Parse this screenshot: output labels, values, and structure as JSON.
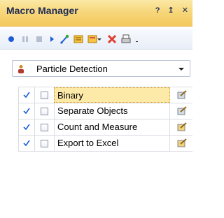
{
  "window": {
    "title": "Macro Manager",
    "title_buttons": "?  ×"
  },
  "toolbar": {
    "items": [
      {
        "name": "record-icon"
      },
      {
        "name": "pause-icon"
      },
      {
        "name": "stop-icon"
      },
      {
        "name": "play-icon"
      },
      {
        "name": "step-icon"
      },
      {
        "name": "macro-insert-icon"
      },
      {
        "name": "macro-dropdown-icon"
      },
      {
        "name": "delete-icon"
      },
      {
        "name": "print-icon"
      }
    ]
  },
  "macro_selector": {
    "label": "Particle Detection",
    "icon": "person-icon"
  },
  "steps": [
    {
      "name": "Binary",
      "checked": true,
      "selected": true
    },
    {
      "name": "Separate Objects",
      "checked": true,
      "selected": false
    },
    {
      "name": "Count and Measure",
      "checked": true,
      "selected": false
    },
    {
      "name": "Export to Excel",
      "checked": true,
      "selected": false
    }
  ],
  "colors": {
    "title_bar": "#f7d77c",
    "selection": "#fde9a8",
    "accent_blue": "#1f5bd6",
    "delete_red": "#e23b2e"
  }
}
